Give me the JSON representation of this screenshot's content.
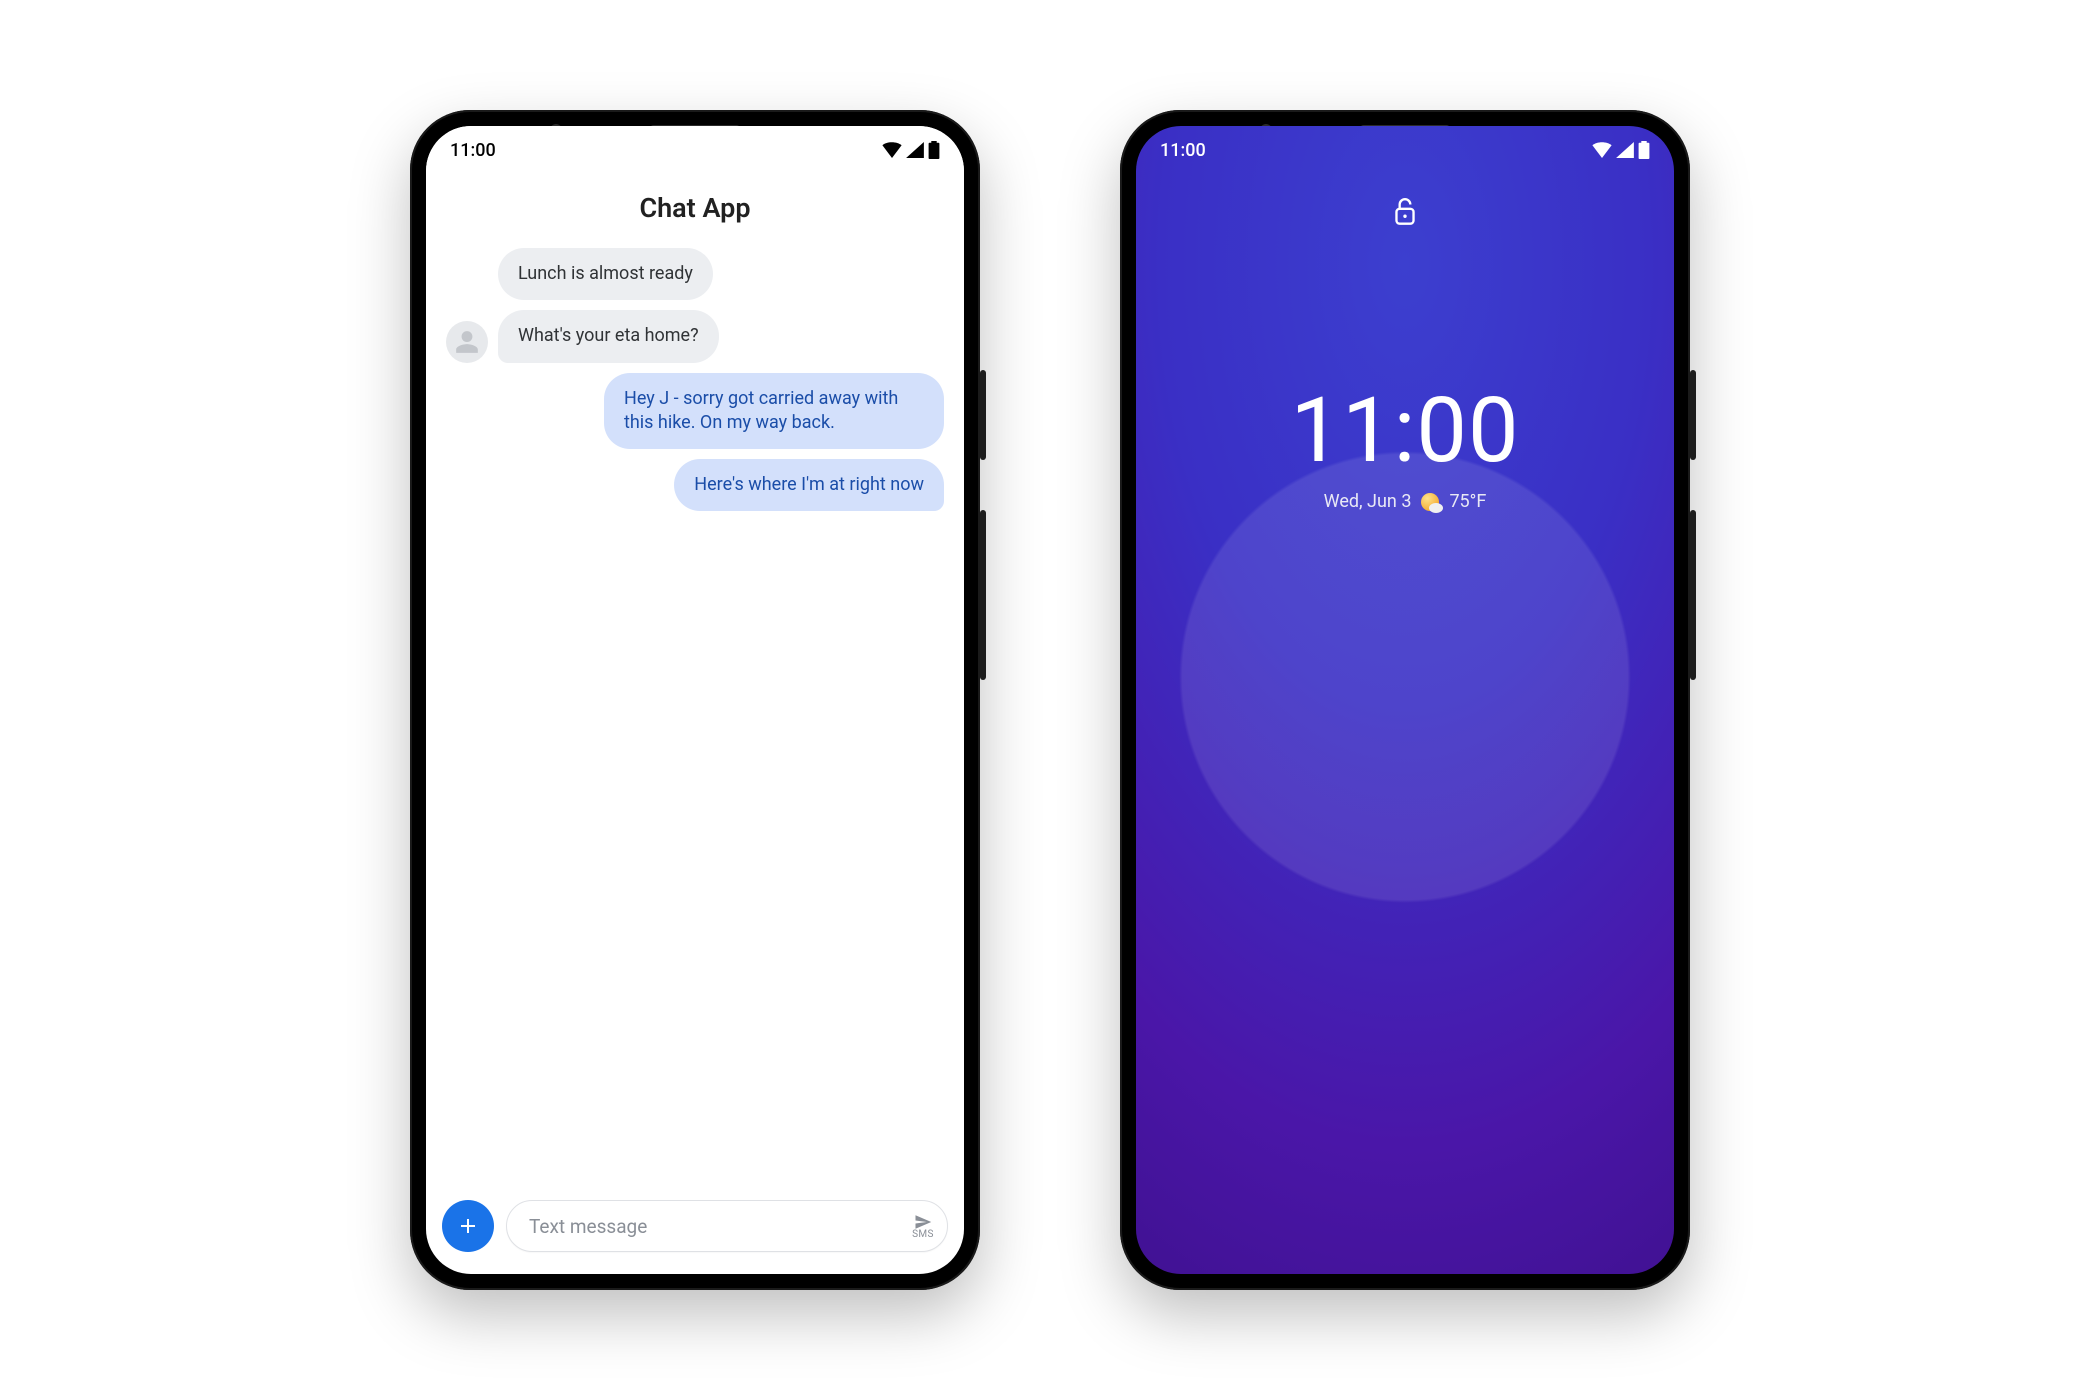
{
  "status": {
    "time": "11:00"
  },
  "chat": {
    "title": "Chat App",
    "messages": {
      "in1": "Lunch is almost ready",
      "in2": "What's your eta home?",
      "out1": "Hey J - sorry got carried away with this hike. On my way back.",
      "out2": "Here's where I'm at right now"
    },
    "composer": {
      "placeholder": "Text message",
      "send_label": "SMS"
    }
  },
  "lock": {
    "time": "11:00",
    "date": "Wed, Jun 3",
    "temp": "75°F"
  }
}
